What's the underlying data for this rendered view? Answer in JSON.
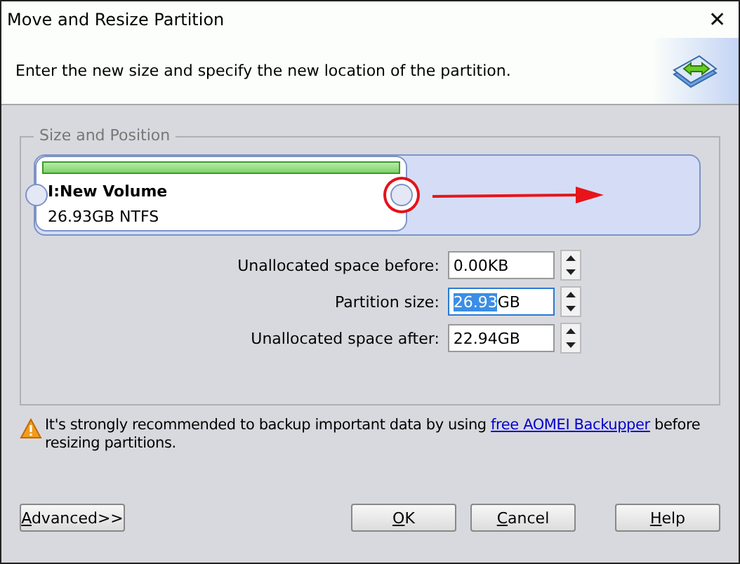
{
  "window": {
    "title": "Move and Resize Partition",
    "close": "✕"
  },
  "header": {
    "instruction": "Enter the new size and specify the new location of the partition."
  },
  "group": {
    "title": "Size and Position",
    "partition": {
      "name": "I:New Volume",
      "detail": "26.93GB NTFS",
      "handle_highlighted": true
    },
    "fields": [
      {
        "label": "Unallocated space before:",
        "value_rest": "0.00KB",
        "focused": false
      },
      {
        "label": "Partition size:",
        "value_selected": "26.93",
        "value_rest": "GB",
        "focused": true
      },
      {
        "label": "Unallocated space after:",
        "value_rest": "22.94GB",
        "focused": false
      }
    ]
  },
  "notice": {
    "before": "It's strongly recommended to backup important data by using ",
    "link": "free AOMEI Backupper",
    "after": " before resizing partitions."
  },
  "buttons": [
    {
      "label": "Advanced>>",
      "underline_first": true,
      "kind": "left"
    },
    {
      "label": "OK",
      "underline_first": true,
      "kind": "right"
    },
    {
      "label": "Cancel",
      "underline_first": true,
      "kind": "right"
    },
    {
      "label": "Help",
      "underline_first": true,
      "kind": "right"
    }
  ]
}
